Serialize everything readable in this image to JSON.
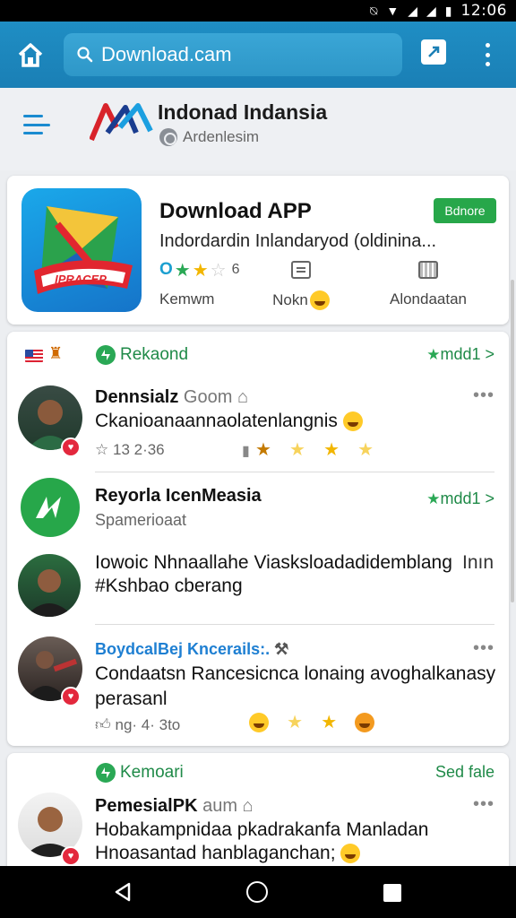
{
  "status": {
    "time": "12:06"
  },
  "toolbar": {
    "url": "Download.cam"
  },
  "site": {
    "name": "Indonad Indansia",
    "subtitle": "Ardenlesim"
  },
  "app": {
    "title": "Download APP",
    "install_label": "Bdnore",
    "description": "Indordardin Inlandaryod (oldinina...",
    "icon_text": "IPRACEP",
    "rating_prefix": "O",
    "rating_count": "6",
    "meta_labels": [
      "Kemwm",
      "Nokn",
      "Alondaatan"
    ]
  },
  "feed": {
    "section1": {
      "label": "Rekaond",
      "right": "mdd1 >"
    },
    "post1": {
      "name": "Dennsialz",
      "name_muted": "Goom",
      "text": "Ckanioanaannaolatenlangnis",
      "stats": "13  2·36"
    },
    "post2": {
      "name": "Reyorla IcenMeasia",
      "sub": "Spamerioaat",
      "right": "mdd1 >"
    },
    "post3": {
      "text_line1": "Iowoic Nhnaallahe Viasksloadadidemblang",
      "text_right": "Inın",
      "text_line2": "#Kshbao cberang"
    },
    "post4": {
      "name": "BoydcalBej Kncerails:.",
      "text": "Condaatsn Rancesicnca lonaing avoghalkanasy perasanl",
      "stats": "ng· 4· 3to"
    }
  },
  "feed2": {
    "section": {
      "label": "Kemoari",
      "right": "Sed fale"
    },
    "post": {
      "name": "PemesialPK",
      "name_muted": "aum",
      "text_line1": "Hobakampnidaa pkadrakanfa Manladan",
      "text_line2": "Hnoasantad hanblaganchan;"
    }
  }
}
